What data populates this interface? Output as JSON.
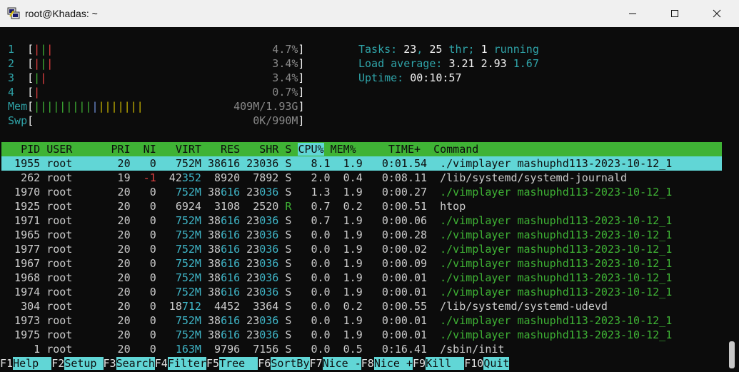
{
  "window": {
    "title": "root@Khadas: ~",
    "icon": "putty-icon",
    "buttons": [
      "minimize-icon",
      "maximize-icon",
      "close-icon"
    ]
  },
  "meters": {
    "cpus": [
      {
        "label": "1",
        "bar": [
          "|",
          "|",
          "|"
        ],
        "colors": [
          "#e04040",
          "#3fb335",
          "#e04040"
        ],
        "value": "4.7%"
      },
      {
        "label": "2",
        "bar": [
          "|",
          "|",
          "|"
        ],
        "colors": [
          "#e04040",
          "#3fb335",
          "#e04040"
        ],
        "value": "3.4%"
      },
      {
        "label": "3",
        "bar": [
          "|",
          "|"
        ],
        "colors": [
          "#3fb335",
          "#e04040"
        ],
        "value": "3.4%"
      },
      {
        "label": "4",
        "bar": [
          "|"
        ],
        "colors": [
          "#e04040"
        ],
        "value": "0.7%"
      }
    ],
    "mem": {
      "label": "Mem",
      "value": "409M/1.93G"
    },
    "swp": {
      "label": "Swp",
      "value": "0K/990M"
    }
  },
  "summary": {
    "tasks_label": "Tasks: ",
    "tasks": "23",
    "thr": "25",
    "running": "1",
    "load_label": "Load average: ",
    "load1": "3.21",
    "load5": "2.93",
    "load15": "1.67",
    "uptime_label": "Uptime: ",
    "uptime": "00:10:57"
  },
  "table": {
    "columns": [
      "PID",
      "USER",
      "PRI",
      "NI",
      "VIRT",
      "RES",
      "SHR",
      "S",
      "CPU%",
      "MEM%",
      "TIME+",
      "Command"
    ],
    "sorted_column": "CPU%",
    "rows": [
      {
        "pid": "1955",
        "user": "root",
        "pri": "20",
        "ni": "0",
        "virt": "752M",
        "res": "38616",
        "shr": "23036",
        "s": "S",
        "cpu": "8.1",
        "mem": "1.9",
        "time": "0:01.54",
        "cmd": "./vimplayer mashuphd113-2023-10-12_1",
        "selected": true
      },
      {
        "pid": "262",
        "user": "root",
        "pri": "19",
        "ni": "-1",
        "virt": "42352",
        "res": "8920",
        "shr": "7892",
        "s": "S",
        "cpu": "2.0",
        "mem": "0.4",
        "time": "0:08.11",
        "cmd": "/lib/systemd/systemd-journald"
      },
      {
        "pid": "1970",
        "user": "root",
        "pri": "20",
        "ni": "0",
        "virt": "752M",
        "res": "38616",
        "shr": "23036",
        "s": "S",
        "cpu": "1.3",
        "mem": "1.9",
        "time": "0:00.27",
        "cmd": "./vimplayer mashuphd113-2023-10-12_1",
        "thread": true
      },
      {
        "pid": "1925",
        "user": "root",
        "pri": "20",
        "ni": "0",
        "virt": "6924",
        "res": "3108",
        "shr": "2520",
        "s": "R",
        "cpu": "0.7",
        "mem": "0.2",
        "time": "0:00.51",
        "cmd": "htop"
      },
      {
        "pid": "1971",
        "user": "root",
        "pri": "20",
        "ni": "0",
        "virt": "752M",
        "res": "38616",
        "shr": "23036",
        "s": "S",
        "cpu": "0.7",
        "mem": "1.9",
        "time": "0:00.06",
        "cmd": "./vimplayer mashuphd113-2023-10-12_1",
        "thread": true
      },
      {
        "pid": "1965",
        "user": "root",
        "pri": "20",
        "ni": "0",
        "virt": "752M",
        "res": "38616",
        "shr": "23036",
        "s": "S",
        "cpu": "0.0",
        "mem": "1.9",
        "time": "0:00.28",
        "cmd": "./vimplayer mashuphd113-2023-10-12_1",
        "thread": true
      },
      {
        "pid": "1977",
        "user": "root",
        "pri": "20",
        "ni": "0",
        "virt": "752M",
        "res": "38616",
        "shr": "23036",
        "s": "S",
        "cpu": "0.0",
        "mem": "1.9",
        "time": "0:00.02",
        "cmd": "./vimplayer mashuphd113-2023-10-12_1",
        "thread": true
      },
      {
        "pid": "1967",
        "user": "root",
        "pri": "20",
        "ni": "0",
        "virt": "752M",
        "res": "38616",
        "shr": "23036",
        "s": "S",
        "cpu": "0.0",
        "mem": "1.9",
        "time": "0:00.09",
        "cmd": "./vimplayer mashuphd113-2023-10-12_1",
        "thread": true
      },
      {
        "pid": "1968",
        "user": "root",
        "pri": "20",
        "ni": "0",
        "virt": "752M",
        "res": "38616",
        "shr": "23036",
        "s": "S",
        "cpu": "0.0",
        "mem": "1.9",
        "time": "0:00.01",
        "cmd": "./vimplayer mashuphd113-2023-10-12_1",
        "thread": true
      },
      {
        "pid": "1974",
        "user": "root",
        "pri": "20",
        "ni": "0",
        "virt": "752M",
        "res": "38616",
        "shr": "23036",
        "s": "S",
        "cpu": "0.0",
        "mem": "1.9",
        "time": "0:00.01",
        "cmd": "./vimplayer mashuphd113-2023-10-12_1",
        "thread": true
      },
      {
        "pid": "304",
        "user": "root",
        "pri": "20",
        "ni": "0",
        "virt": "18712",
        "res": "4452",
        "shr": "3364",
        "s": "S",
        "cpu": "0.0",
        "mem": "0.2",
        "time": "0:00.55",
        "cmd": "/lib/systemd/systemd-udevd"
      },
      {
        "pid": "1973",
        "user": "root",
        "pri": "20",
        "ni": "0",
        "virt": "752M",
        "res": "38616",
        "shr": "23036",
        "s": "S",
        "cpu": "0.0",
        "mem": "1.9",
        "time": "0:00.01",
        "cmd": "./vimplayer mashuphd113-2023-10-12_1",
        "thread": true
      },
      {
        "pid": "1975",
        "user": "root",
        "pri": "20",
        "ni": "0",
        "virt": "752M",
        "res": "38616",
        "shr": "23036",
        "s": "S",
        "cpu": "0.0",
        "mem": "1.9",
        "time": "0:00.01",
        "cmd": "./vimplayer mashuphd113-2023-10-12_1",
        "thread": true
      },
      {
        "pid": "1",
        "user": "root",
        "pri": "20",
        "ni": "0",
        "virt": "163M",
        "res": "9796",
        "shr": "7156",
        "s": "S",
        "cpu": "0.0",
        "mem": "0.5",
        "time": "0:16.41",
        "cmd": "/sbin/init"
      }
    ]
  },
  "function_keys": [
    {
      "key": "F1",
      "label": "Help  "
    },
    {
      "key": "F2",
      "label": "Setup "
    },
    {
      "key": "F3",
      "label": "Search"
    },
    {
      "key": "F4",
      "label": "Filter"
    },
    {
      "key": "F5",
      "label": "Tree  "
    },
    {
      "key": "F6",
      "label": "SortBy"
    },
    {
      "key": "F7",
      "label": "Nice -"
    },
    {
      "key": "F8",
      "label": "Nice +"
    },
    {
      "key": "F9",
      "label": "Kill  "
    },
    {
      "key": "F10",
      "label": "Quit"
    }
  ],
  "colors": {
    "header_bg": "#3fb335",
    "selected_bg": "#61d6d6",
    "terminal_bg": "#0c0c0c",
    "thread_fg": "#3fb335",
    "summary_fg": "#3fb6c8"
  }
}
